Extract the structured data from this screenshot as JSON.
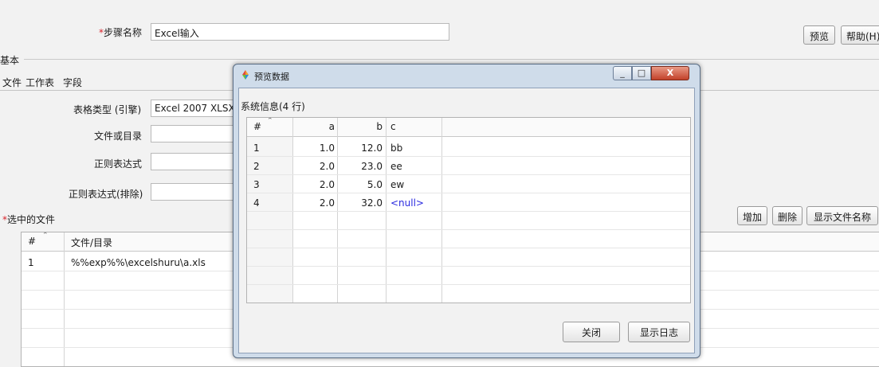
{
  "form": {
    "step_name_label": "步骤名称",
    "step_name_required": "*",
    "step_name_value": "Excel输入",
    "preview_button": "预览",
    "help_button": "帮助(H)"
  },
  "group_label": "基本",
  "tabs": [
    "文件",
    "工作表",
    "字段"
  ],
  "fields": {
    "sheet_type_label": "表格类型 (引擎)",
    "sheet_type_value": "Excel 2007 XLSX",
    "file_or_dir_label": "文件或目录",
    "regex_label": "正则表达式",
    "regex_exclude_label": "正则表达式(排除)"
  },
  "selected_files": {
    "label": "选中的文件",
    "required": "*",
    "add_button": "增加",
    "delete_button": "删除",
    "show_names_button": "显示文件名称",
    "columns": [
      "#",
      "文件/目录"
    ],
    "rows": [
      [
        "1",
        "%%exp%%\\excelshuru\\a.xls"
      ]
    ]
  },
  "dialog": {
    "title": "预览数据",
    "window_buttons": [
      "_",
      "□",
      "X"
    ],
    "info": "系统信息(4 行)",
    "columns": [
      "#",
      "a",
      "b",
      "c"
    ],
    "rows": [
      [
        "1",
        "1.0",
        "12.0",
        "bb"
      ],
      [
        "2",
        "2.0",
        "23.0",
        "ee"
      ],
      [
        "3",
        "2.0",
        "5.0",
        "ew"
      ],
      [
        "4",
        "2.0",
        "32.0",
        "<null>"
      ]
    ],
    "null_color": "#2a2ae0",
    "close_button": "关闭",
    "show_log_button": "显示日志"
  }
}
